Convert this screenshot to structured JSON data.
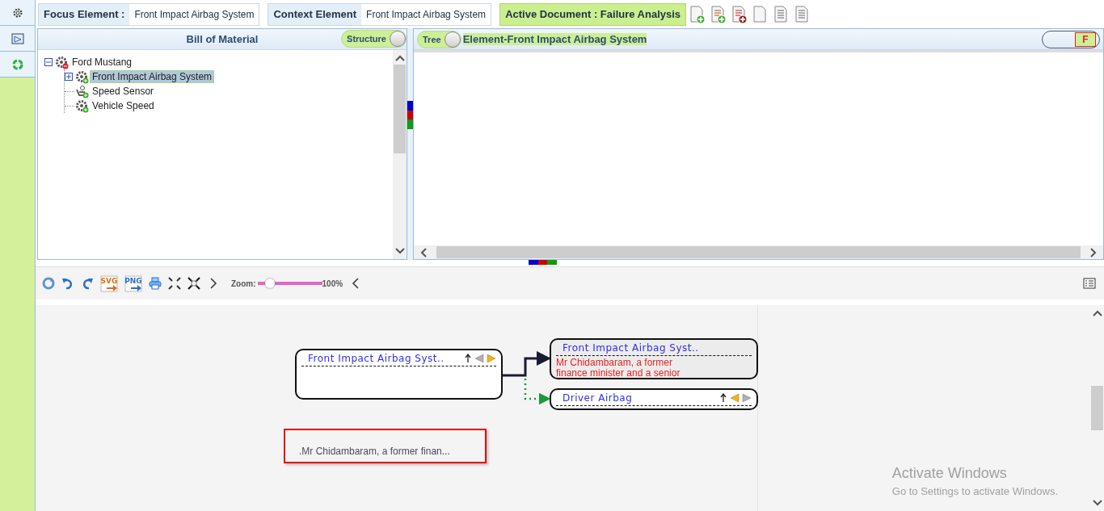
{
  "header": {
    "focus_element": {
      "label": "Focus Element :",
      "value": "Front Impact Airbag System"
    },
    "context_element": {
      "label": "Context Element",
      "value": "Front Impact Airbag System"
    },
    "active_document": "Active Document : Failure Analysis"
  },
  "bom_panel": {
    "title": "Bill of Material",
    "toggle": {
      "label": "Structure",
      "on": true
    },
    "tree": [
      {
        "label": "Ford Mustang",
        "kind": "root",
        "expanded": true,
        "selected": false,
        "children": [
          {
            "label": "Front Impact Airbag System",
            "kind": "part",
            "expanded": false,
            "selected": true
          },
          {
            "label": "Speed Sensor",
            "kind": "sensor",
            "selected": false
          },
          {
            "label": "Vehicle Speed",
            "kind": "part",
            "selected": false
          }
        ]
      }
    ]
  },
  "element_panel": {
    "toggle": {
      "label": "Tree",
      "on": true
    },
    "title": "Element-Front Impact Airbag System",
    "flag": "F"
  },
  "toolbar": {
    "tools": [
      {
        "kind": "refresh"
      },
      {
        "kind": "undo"
      },
      {
        "kind": "redo"
      },
      {
        "kind": "export",
        "label": "SVG"
      },
      {
        "kind": "export",
        "label": "PNG"
      },
      {
        "kind": "print"
      },
      {
        "kind": "fit"
      },
      {
        "kind": "fullscreen"
      },
      {
        "kind": "next"
      }
    ],
    "zoom_label": "Zoom:",
    "zoom": {
      "level": 0.19
    },
    "zoom_reading": "100%"
  },
  "diagram": {
    "nodes": [
      {
        "title": "Front Impact Airbag Syst..",
        "kind": "main",
        "nav": {
          "left_on": false,
          "right_on": true
        }
      },
      {
        "title": "Front Impact Airbag Syst..",
        "kind": "detail",
        "description": "Mr Chidambaram, a former\nfinance minister and a senior"
      },
      {
        "title": "Driver Airbag",
        "kind": "child",
        "nav": {
          "left_on": true,
          "right_on": false
        }
      }
    ],
    "note": ".Mr Chidambaram, a former finan..."
  },
  "os_notice": {
    "title": "Activate Windows",
    "text": "Go to Settings to activate Windows."
  }
}
